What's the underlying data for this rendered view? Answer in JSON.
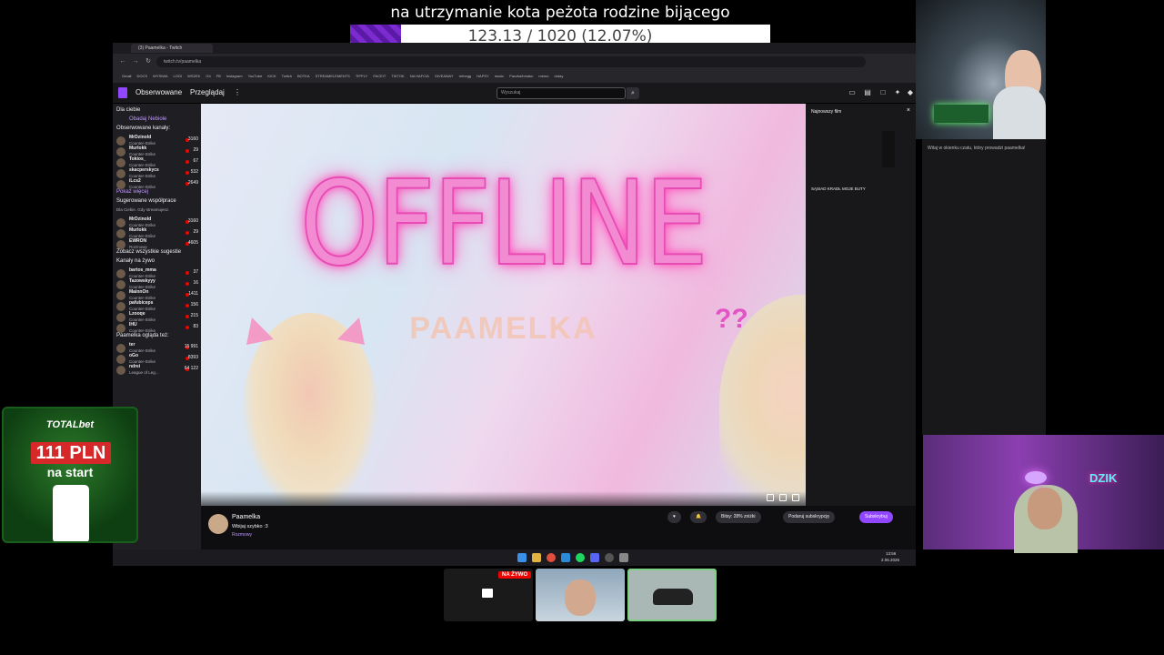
{
  "goal": {
    "title": "na utrzymanie kota pеżota rodzine bijącego",
    "progress_text": "123.13 / 1020 (12.07%)",
    "progress_fraction": 0.1207
  },
  "browser": {
    "tab_label": "(3) Paamelka - Twitch",
    "url": "twitch.tv/paamelka",
    "bookmarks": [
      "Gmail",
      "DOCS",
      "WYSIWA",
      "LOGI",
      "WSZEK",
      "G4",
      "FB",
      "Instagram",
      "YouTube",
      "KICK",
      "Twitch",
      "BOTKA",
      "STREAMELEMENTS",
      "TIPPLY",
      "FACEIT",
      "TIKTOK",
      "NA HAFCIA",
      "GIVEAWAY",
      "refnegg",
      "HAPSY",
      "music",
      "Paczka/bmaku",
      "memo",
      "dotay"
    ]
  },
  "twitch": {
    "nav": {
      "following": "Obserwowane",
      "browse": "Przeglądaj",
      "search_placeholder": "Wyszukaj"
    },
    "sidebar": {
      "for_you": "Dla ciebie",
      "promo": "Obadaj Nebiole",
      "followed_header": "Obserwowane kanały:",
      "followed": [
        {
          "name": "MrDzinold",
          "game": "Counter-Strike",
          "viewers": "3160"
        },
        {
          "name": "Murlokk",
          "game": "Counter-Strike",
          "viewers": "29"
        },
        {
          "name": "Tokios_",
          "game": "Counter-Strike",
          "viewers": "67"
        },
        {
          "name": "skacperskycs",
          "game": "Counter-Strike",
          "viewers": "532"
        },
        {
          "name": "iLcs2",
          "game": "Counter-Strike",
          "viewers": "2649"
        }
      ],
      "show_more": "Pokaż więcej",
      "suggested_header": "Sugerowane współprace",
      "suggested_sub": "Dla Ciebie. Gdy streamujesz.",
      "suggested": [
        {
          "name": "MrDzinold",
          "game": "Counter-Strike",
          "viewers": "3160"
        },
        {
          "name": "Murlokk",
          "game": "Counter-Strike",
          "viewers": "29"
        },
        {
          "name": "EWRON",
          "game": "Rozmowy",
          "viewers": "4605"
        }
      ],
      "see_all": "Zobacz wszystkie sugestie",
      "live_header": "Kanały na żywo",
      "live": [
        {
          "name": "bartos_mma",
          "game": "Counter-Strike",
          "viewers": "37"
        },
        {
          "name": "Tazowskyyy",
          "game": "Counter-Strike",
          "viewers": "16"
        },
        {
          "name": "MainnOn",
          "game": "Counter-Strike",
          "viewers": "1411"
        },
        {
          "name": "pafubiceps",
          "game": "Counter-Strike",
          "viewers": "156"
        },
        {
          "name": "Lzooqe",
          "game": "Counter-Strike",
          "viewers": "215"
        },
        {
          "name": "IHU",
          "game": "Counter-Strike",
          "viewers": "83"
        }
      ],
      "watching_header": "Paamelka ogląda też:",
      "watching": [
        {
          "name": "ter",
          "game": "Counter-Strike",
          "viewers": "15 991"
        },
        {
          "name": "oGo",
          "game": "Counter-Strike",
          "viewers": "8393"
        },
        {
          "name": "ndrei",
          "game": "League of Leg...",
          "viewers": "64 122"
        }
      ]
    },
    "player": {
      "offline_text": "OFFLINE",
      "channel_art": "PAAMELKA",
      "mark_left": "??"
    },
    "channel": {
      "name": "Paamelka",
      "title": "Wbijaj szybko :3",
      "category": "Rozmowy",
      "bits": "Bitsy: 28% zniżki",
      "gift": "Podaruj subskrypcję",
      "subscribe": "Subskrybuj"
    },
    "latest": {
      "header": "Najnowszy film",
      "caption": "SĄSIAD KRADŁ MOJE BUTY"
    },
    "chat_msg": "Witaj w okienku czatu, który prowadzi paamelka!"
  },
  "taskbar": {
    "time": "13:56",
    "date": "2.06.2026"
  },
  "overlay": {
    "dzik": "DZIK"
  },
  "ad": {
    "brand": "TOTALbet",
    "amount": "111 PLN",
    "sub": "na start"
  },
  "windows": {
    "live_badge": "NA ŻYWO"
  },
  "colors": {
    "twitch_purple": "#9147ff",
    "live_red": "#eb0400",
    "offline_pink": "#f38bd2"
  }
}
